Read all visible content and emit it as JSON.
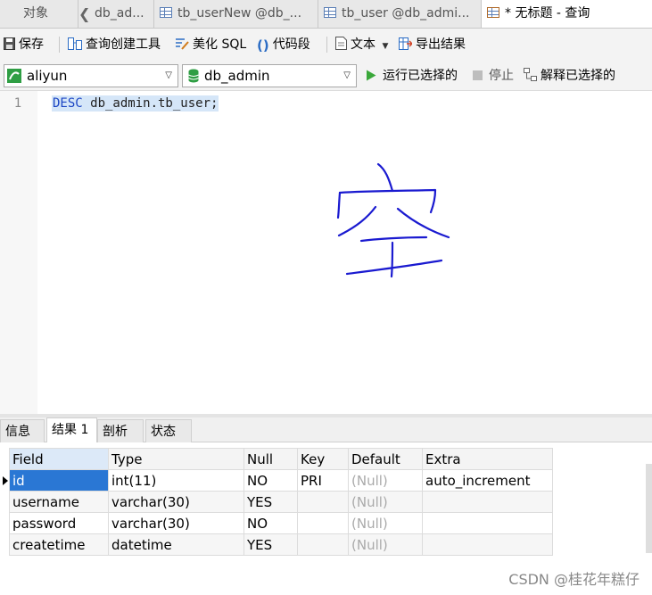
{
  "tabs": [
    {
      "label": "对象"
    },
    {
      "label": "db_ad..."
    },
    {
      "label": "tb_userNew @db_..."
    },
    {
      "label": "tb_user @db_admi..."
    },
    {
      "label": "* 无标题 - 查询"
    }
  ],
  "toolbar": {
    "save": "保存",
    "query_builder": "查询创建工具",
    "beautify_sql": "美化 SQL",
    "code_snippet": "代码段",
    "text": "文本",
    "export": "导出结果"
  },
  "connection": {
    "server": "aliyun",
    "database": "db_admin",
    "run_selected": "运行已选择的",
    "stop": "停止",
    "explain_selected": "解释已选择的"
  },
  "editor": {
    "line_number": "1",
    "keyword": "DESC",
    "statement_rest": " db_admin.tb_user;"
  },
  "result_tabs": [
    "信息",
    "结果 1",
    "剖析",
    "状态"
  ],
  "result_grid": {
    "columns": [
      "Field",
      "Type",
      "Null",
      "Key",
      "Default",
      "Extra"
    ],
    "rows": [
      [
        "id",
        "int(11)",
        "NO",
        "PRI",
        "(Null)",
        "auto_increment"
      ],
      [
        "username",
        "varchar(30)",
        "YES",
        "",
        "(Null)",
        ""
      ],
      [
        "password",
        "varchar(30)",
        "NO",
        "",
        "(Null)",
        ""
      ],
      [
        "createtime",
        "datetime",
        "YES",
        "",
        "(Null)",
        ""
      ]
    ]
  },
  "watermark": "CSDN @桂花年糕仔",
  "colors": {
    "selection": "#2a77d4",
    "keyword": "#1c46c4",
    "annotation_ink": "#1a1ad0",
    "run_green": "#3aa83a"
  }
}
